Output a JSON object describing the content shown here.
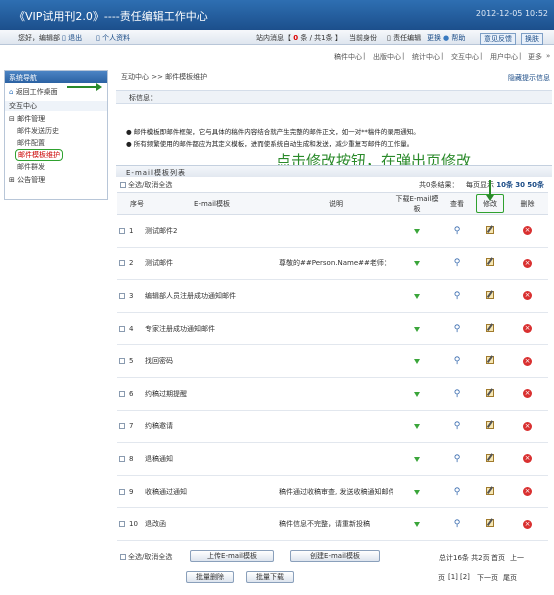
{
  "banner": {
    "title": "《VIP试用刊2.0》----责任编辑工作中心",
    "date": "2012-12-05 10:52"
  },
  "userbar": {
    "greeting": "您好，编辑部",
    "logout": "退出",
    "profile": "个人资料",
    "messages_label": "站内消息【",
    "messages_new": "0",
    "messages_rest": "条 / 共1条 】",
    "identity_label": "当前身份",
    "identity_value": "责任编辑",
    "change": "更换",
    "help": "帮助",
    "feedback": "意见反馈",
    "switch": "换肤"
  },
  "topnav": [
    "稿件中心",
    "出版中心",
    "统计中心",
    "交互中心",
    "用户中心",
    "更多"
  ],
  "sidebar": {
    "title": "系统导航",
    "home": "返回工作桌面",
    "section": "交互中心",
    "group1": "邮件管理",
    "items": [
      "邮件发送历史",
      "邮件配置",
      "邮件模板维护",
      "邮件群发"
    ],
    "group2": "公告管理"
  },
  "main": {
    "breadcrumb": "互动中心 >> 邮件模板维护",
    "hide_tip": "隐藏提示信息",
    "info_label": "标信息：",
    "bullets": [
      "邮件模板即邮件框架，它与具体的稿件内容结合就产生完整的邮件正文，如一对**稿件的录用通知。",
      "所有频繁使用的邮件都应为其定义模板，进而使系统自动生成和发送，减少重复写邮件的工作量。"
    ],
    "annotation": "点击修改按钮，在弹出页修改",
    "table_title": "E-mail模板列表",
    "select_all": "全选/取消全选",
    "count_text": "共0条结果：",
    "per_page_label": "每页显示",
    "per_page": [
      "10条",
      "30",
      "50条"
    ],
    "columns": [
      "序号",
      "E-mail模板",
      "说明",
      "下载E-mail模板",
      "查看",
      "修改",
      "删除"
    ],
    "rows": [
      {
        "no": "1",
        "name": "测试邮件2",
        "desc": ""
      },
      {
        "no": "2",
        "name": "测试邮件",
        "desc": "尊敬的##Person.Name##老师："
      },
      {
        "no": "3",
        "name": "编辑部人员注册成功通知邮件",
        "desc": ""
      },
      {
        "no": "4",
        "name": "专家注册成功通知邮件",
        "desc": ""
      },
      {
        "no": "5",
        "name": "找回密码",
        "desc": ""
      },
      {
        "no": "6",
        "name": "约稿过期提醒",
        "desc": ""
      },
      {
        "no": "7",
        "name": "约稿邀请",
        "desc": ""
      },
      {
        "no": "8",
        "name": "退稿通知",
        "desc": ""
      },
      {
        "no": "9",
        "name": "收稿通过通知",
        "desc": "稿件通过收稿审查, 发送收稿通知邮件"
      },
      {
        "no": "10",
        "name": "退改函",
        "desc": "稿件信息不完整，请重新投稿"
      }
    ],
    "buttons": {
      "upload": "上传E-mail模板",
      "create": "创建E-mail模板",
      "batch_delete": "批量删除",
      "batch_download": "批量下载"
    },
    "footer": {
      "total": "总计16条 共2页",
      "first": "首页",
      "prev": "上一",
      "pages_label": "页",
      "page1": "[1]",
      "page2": "[2]",
      "next": "下一页",
      "last": "尾页"
    }
  }
}
